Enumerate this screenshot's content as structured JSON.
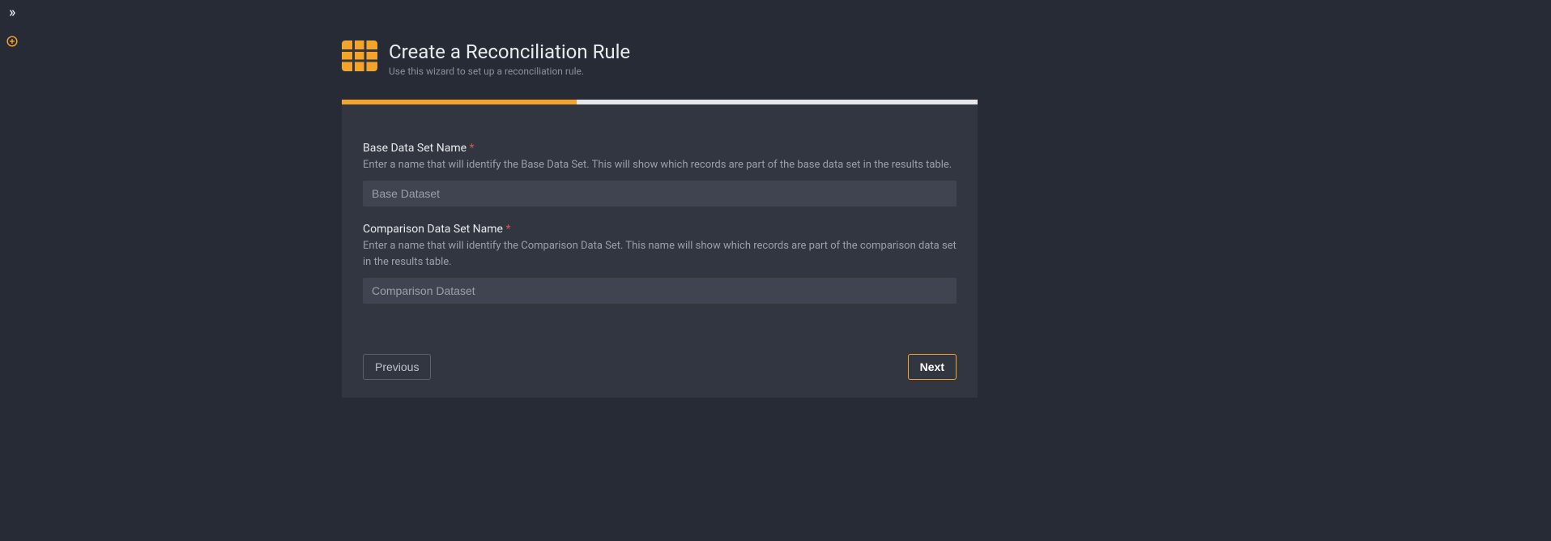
{
  "header": {
    "title": "Create a Reconciliation Rule",
    "subtitle": "Use this wizard to set up a reconciliation rule."
  },
  "form": {
    "base": {
      "label": "Base Data Set Name",
      "required_marker": "*",
      "description": "Enter a name that will identify the Base Data Set. This will show which records are part of the base data set in the results table.",
      "placeholder": "Base Dataset",
      "value": ""
    },
    "comparison": {
      "label": "Comparison Data Set Name",
      "required_marker": "*",
      "description": "Enter a name that will identify the Comparison Data Set. This name will show which records are part of the comparison data set in the results table.",
      "placeholder": "Comparison Dataset",
      "value": ""
    }
  },
  "buttons": {
    "previous": "Previous",
    "next": "Next"
  },
  "icons": {
    "expand": "chevron-right-double",
    "add": "plus-circle",
    "grid": "table-grid"
  },
  "colors": {
    "accent": "#f4a428",
    "background": "#272b35",
    "card": "#323641"
  },
  "progress": {
    "percent": 37
  }
}
